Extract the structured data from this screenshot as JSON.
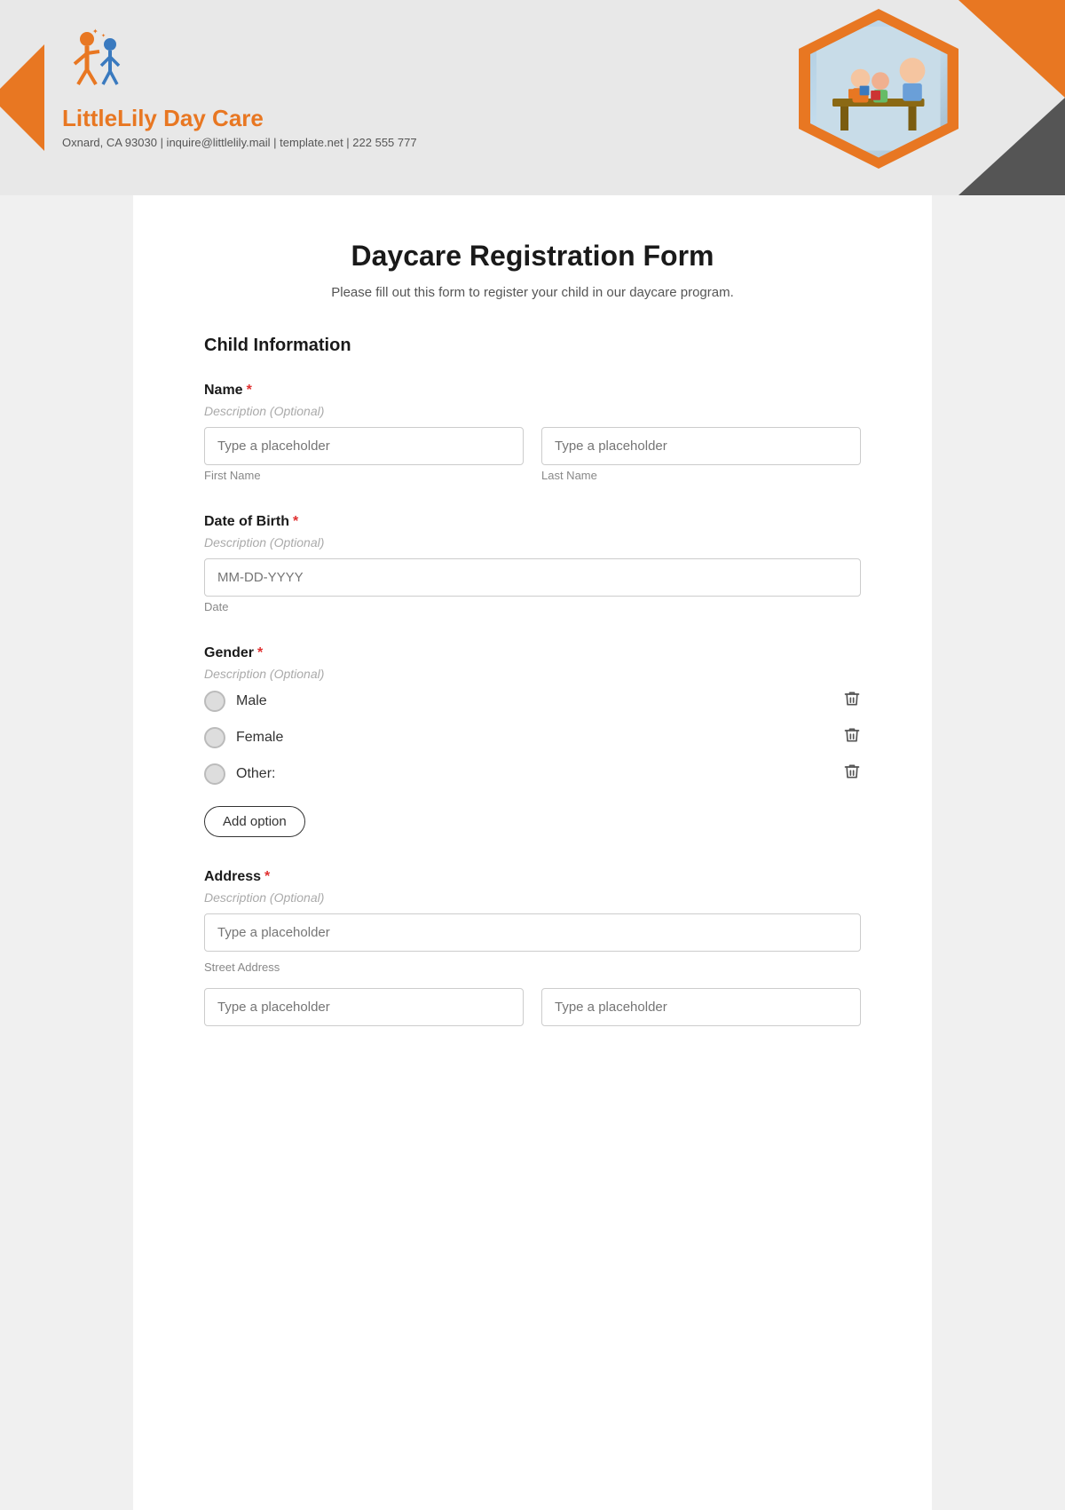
{
  "header": {
    "logo_title": "LittleLily Day Care",
    "logo_subtitle": "Oxnard, CA 93030 | inquire@littlelily.mail | template.net | 222 555 777"
  },
  "form": {
    "title": "Daycare Registration Form",
    "subtitle": "Please fill out this form to register your child in our daycare program.",
    "section_child": "Child Information",
    "fields": {
      "name": {
        "label": "Name",
        "required": true,
        "description": "Description (Optional)",
        "first_name_placeholder": "Type a placeholder",
        "last_name_placeholder": "Type a placeholder",
        "first_name_sublabel": "First Name",
        "last_name_sublabel": "Last Name"
      },
      "dob": {
        "label": "Date of Birth",
        "required": true,
        "description": "Description (Optional)",
        "placeholder": "MM-DD-YYYY",
        "sublabel": "Date"
      },
      "gender": {
        "label": "Gender",
        "required": true,
        "description": "Description (Optional)",
        "options": [
          {
            "label": "Male"
          },
          {
            "label": "Female"
          },
          {
            "label": "Other:"
          }
        ],
        "add_option_label": "Add option"
      },
      "address": {
        "label": "Address",
        "required": true,
        "description": "Description (Optional)",
        "street_placeholder": "Type a placeholder",
        "street_sublabel": "Street Address"
      }
    }
  }
}
